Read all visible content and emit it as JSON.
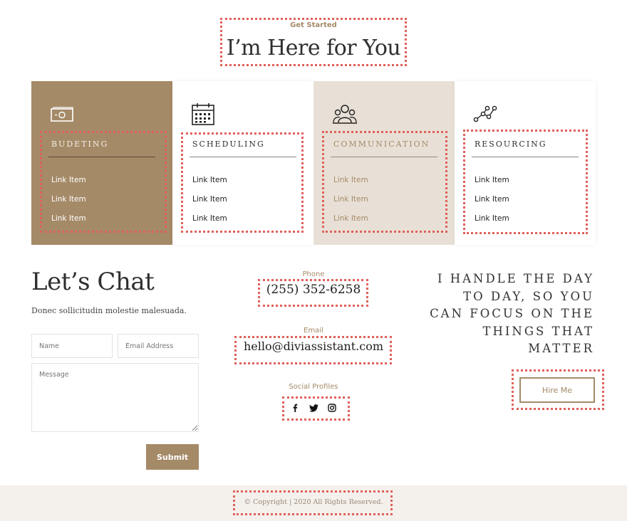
{
  "header": {
    "eyebrow": "Get Started",
    "title": "I’m Here for You"
  },
  "cards": [
    {
      "title": "BUDETING",
      "icon": "money-icon",
      "links": [
        "Link Item",
        "Link Item",
        "Link Item"
      ],
      "bg": "#a58a68",
      "title_color": "#f4ede4",
      "link_color": "#ffffff",
      "rule_color": "#5e4a34"
    },
    {
      "title": "SCHEDULING",
      "icon": "calendar-icon",
      "links": [
        "Link Item",
        "Link Item",
        "Link Item"
      ],
      "bg": "#ffffff",
      "title_color": "#2f2f2f",
      "link_color": "#222222",
      "rule_color": "#888888"
    },
    {
      "title": "COMMUNICATION",
      "icon": "group-icon",
      "links": [
        "Link Item",
        "Link Item",
        "Link Item"
      ],
      "bg": "#e8e0d6",
      "title_color": "#a58a68",
      "link_color": "#a58a68",
      "rule_color": "#888888"
    },
    {
      "title": "RESOURCING",
      "icon": "network-icon",
      "links": [
        "Link Item",
        "Link Item",
        "Link Item"
      ],
      "bg": "#ffffff",
      "title_color": "#2f2f2f",
      "link_color": "#222222",
      "rule_color": "#888888"
    }
  ],
  "chat": {
    "title": "Let’s Chat",
    "subtitle": "Donec sollicitudin molestie malesuada.",
    "name_placeholder": "Name",
    "email_placeholder": "Email Address",
    "message_placeholder": "Message",
    "submit_label": "Submit"
  },
  "contact": {
    "phone_label": "Phone",
    "phone": "(255) 352-6258",
    "email_label": "Email",
    "email": "hello@diviassistant.com",
    "social_label": "Social Profiles",
    "social_icons": [
      "facebook-icon",
      "twitter-icon",
      "instagram-icon"
    ]
  },
  "quote": {
    "text": "I HANDLE THE DAY TO DAY, SO YOU CAN FOCUS ON THE THINGS THAT MATTER",
    "button_label": "Hire Me"
  },
  "footer": {
    "copyright": "© Copyright | 2020 All Rights Reserved."
  },
  "colors": {
    "accent": "#a58a68",
    "highlight": "#e0605a"
  }
}
